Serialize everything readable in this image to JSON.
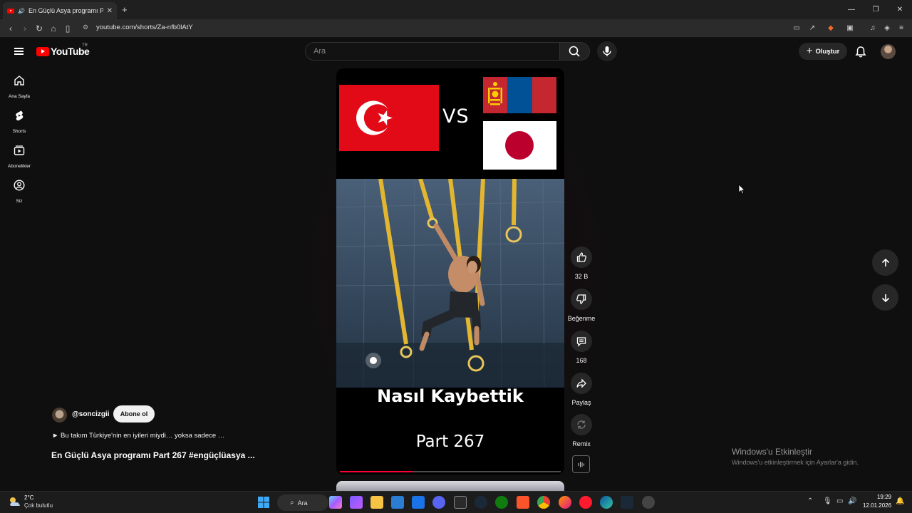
{
  "browser": {
    "tab_title": "En Güçlü Asya programı Part",
    "url": "youtube.com/shorts/Za-nfb0lAtY"
  },
  "header": {
    "logo_text": "YouTube",
    "country_code": "TR",
    "search_placeholder": "Ara",
    "create_label": "Oluştur"
  },
  "sidebar": {
    "items": [
      {
        "label": "Ana Sayfa",
        "icon": "home-icon"
      },
      {
        "label": "Shorts",
        "icon": "shorts-icon"
      },
      {
        "label": "Abonelikler",
        "icon": "subscriptions-icon"
      },
      {
        "label": "Siz",
        "icon": "you-icon"
      }
    ]
  },
  "video": {
    "overlay_vs": "VS",
    "caption_line1": "Nasıl Kaybettik",
    "caption_line2": "Part 267",
    "progress_fraction": 0.33
  },
  "actions": {
    "like_count": "32 B",
    "dislike_label": "Beğenme",
    "comment_count": "168",
    "share_label": "Paylaş",
    "remix_label": "Remix"
  },
  "channel": {
    "handle": "@soncizgii",
    "subscribe_label": "Abone ol",
    "description": "► Bu takım Türkiye'nin en iyileri miydi… yoksa sadece …",
    "title": "En Güçlü Asya programı Part 267 #engüçlüasya ..."
  },
  "watermark": {
    "line1": "Windows'u Etkinleştir",
    "line2": "Windows'u etkinleştirmek için Ayarlar'a gidin."
  },
  "taskbar": {
    "temperature": "2°C",
    "condition": "Çok bulutlu",
    "search_label": "Ara",
    "time": "19:29",
    "date": "12.01.2026"
  },
  "colors": {
    "background": "#0f0f0f",
    "youtube_red": "#ff0000",
    "progress_red": "#ff0033"
  }
}
